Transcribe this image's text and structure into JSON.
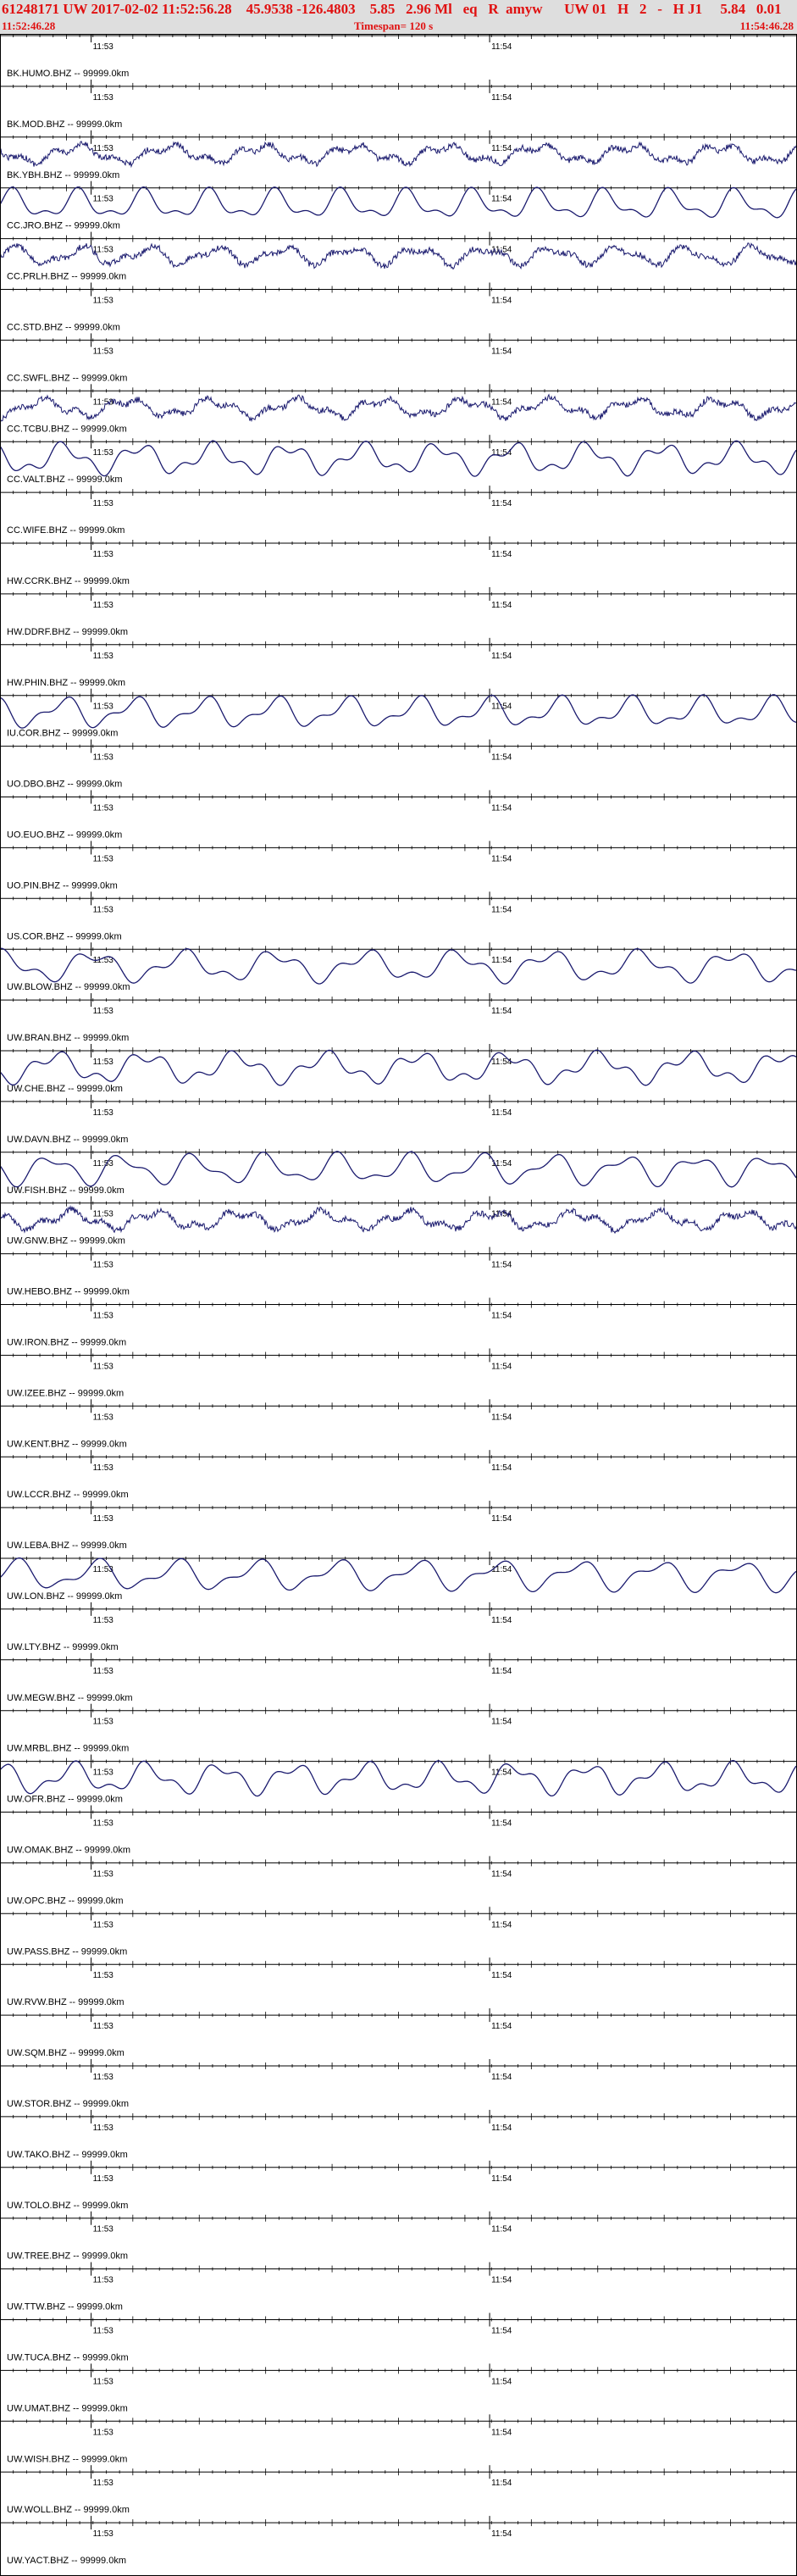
{
  "header": {
    "event_line": "61248171 UW 2017-02-02 11:52:56.28    45.9538 -126.4803    5.85   2.96 Ml   eq   R  amyw      UW 01   H   2   -   H J1     5.84   0.01",
    "start_time": "11:52:46.28",
    "timespan": "Timespan= 120 s",
    "end_time": "11:54:46.28"
  },
  "colors": {
    "header_text": "#e01010",
    "trace": "#1a1a6e",
    "axis": "#000000",
    "header_bg": "#dedede"
  },
  "chart_data": {
    "type": "line",
    "title": "",
    "time_window": {
      "start": "11:52:46.28",
      "end": "11:54:46.28",
      "span_s": 120
    },
    "minute_marks": [
      {
        "label": "11:53",
        "t": 13.72
      },
      {
        "label": "11:54",
        "t": 73.72
      }
    ],
    "traces": [
      {
        "label": "BK.HUMO.BHZ -- 99999.0km",
        "signal": "none"
      },
      {
        "label": "BK.MOD.BHZ -- 99999.0km",
        "signal": "none"
      },
      {
        "label": "BK.YBH.BHZ -- 99999.0km",
        "signal": "noisy"
      },
      {
        "label": "CC.JRO.BHZ -- 99999.0km",
        "signal": "wave"
      },
      {
        "label": "CC.PRLH.BHZ -- 99999.0km",
        "signal": "noisy"
      },
      {
        "label": "CC.STD.BHZ -- 99999.0km",
        "signal": "none"
      },
      {
        "label": "CC.SWFL.BHZ -- 99999.0km",
        "signal": "none"
      },
      {
        "label": "CC.TCBU.BHZ -- 99999.0km",
        "signal": "noisy"
      },
      {
        "label": "CC.VALT.BHZ -- 99999.0km",
        "signal": "wave"
      },
      {
        "label": "CC.WIFE.BHZ -- 99999.0km",
        "signal": "none"
      },
      {
        "label": "HW.CCRK.BHZ -- 99999.0km",
        "signal": "none"
      },
      {
        "label": "HW.DDRF.BHZ -- 99999.0km",
        "signal": "none"
      },
      {
        "label": "HW.PHIN.BHZ -- 99999.0km",
        "signal": "none"
      },
      {
        "label": "IU.COR.BHZ -- 99999.0km",
        "signal": "wave"
      },
      {
        "label": "UO.DBO.BHZ -- 99999.0km",
        "signal": "none"
      },
      {
        "label": "UO.EUO.BHZ -- 99999.0km",
        "signal": "none"
      },
      {
        "label": "UO.PIN.BHZ -- 99999.0km",
        "signal": "none"
      },
      {
        "label": "US.COR.BHZ -- 99999.0km",
        "signal": "none"
      },
      {
        "label": "UW.BLOW.BHZ -- 99999.0km",
        "signal": "wave"
      },
      {
        "label": "UW.BRAN.BHZ -- 99999.0km",
        "signal": "none"
      },
      {
        "label": "UW.CHE.BHZ -- 99999.0km",
        "signal": "wave"
      },
      {
        "label": "UW.DAVN.BHZ -- 99999.0km",
        "signal": "none"
      },
      {
        "label": "UW.FISH.BHZ -- 99999.0km",
        "signal": "wave"
      },
      {
        "label": "UW.GNW.BHZ -- 99999.0km",
        "signal": "noisy"
      },
      {
        "label": "UW.HEBO.BHZ -- 99999.0km",
        "signal": "none"
      },
      {
        "label": "UW.IRON.BHZ -- 99999.0km",
        "signal": "none"
      },
      {
        "label": "UW.IZEE.BHZ -- 99999.0km",
        "signal": "none"
      },
      {
        "label": "UW.KENT.BHZ -- 99999.0km",
        "signal": "none"
      },
      {
        "label": "UW.LCCR.BHZ -- 99999.0km",
        "signal": "none"
      },
      {
        "label": "UW.LEBA.BHZ -- 99999.0km",
        "signal": "none"
      },
      {
        "label": "UW.LON.BHZ -- 99999.0km",
        "signal": "wave"
      },
      {
        "label": "UW.LTY.BHZ -- 99999.0km",
        "signal": "none"
      },
      {
        "label": "UW.MEGW.BHZ -- 99999.0km",
        "signal": "none"
      },
      {
        "label": "UW.MRBL.BHZ -- 99999.0km",
        "signal": "none"
      },
      {
        "label": "UW.OFR.BHZ -- 99999.0km",
        "signal": "wave"
      },
      {
        "label": "UW.OMAK.BHZ -- 99999.0km",
        "signal": "none"
      },
      {
        "label": "UW.OPC.BHZ -- 99999.0km",
        "signal": "none"
      },
      {
        "label": "UW.PASS.BHZ -- 99999.0km",
        "signal": "none"
      },
      {
        "label": "UW.RVW.BHZ -- 99999.0km",
        "signal": "none"
      },
      {
        "label": "UW.SQM.BHZ -- 99999.0km",
        "signal": "none"
      },
      {
        "label": "UW.STOR.BHZ -- 99999.0km",
        "signal": "none"
      },
      {
        "label": "UW.TAKO.BHZ -- 99999.0km",
        "signal": "none"
      },
      {
        "label": "UW.TOLO.BHZ -- 99999.0km",
        "signal": "none"
      },
      {
        "label": "UW.TREE.BHZ -- 99999.0km",
        "signal": "none"
      },
      {
        "label": "UW.TTW.BHZ -- 99999.0km",
        "signal": "none"
      },
      {
        "label": "UW.TUCA.BHZ -- 99999.0km",
        "signal": "none"
      },
      {
        "label": "UW.UMAT.BHZ -- 99999.0km",
        "signal": "none"
      },
      {
        "label": "UW.WISH.BHZ -- 99999.0km",
        "signal": "none"
      },
      {
        "label": "UW.WOLL.BHZ -- 99999.0km",
        "signal": "none"
      },
      {
        "label": "UW.YACT.BHZ -- 99999.0km",
        "signal": "none"
      }
    ]
  }
}
